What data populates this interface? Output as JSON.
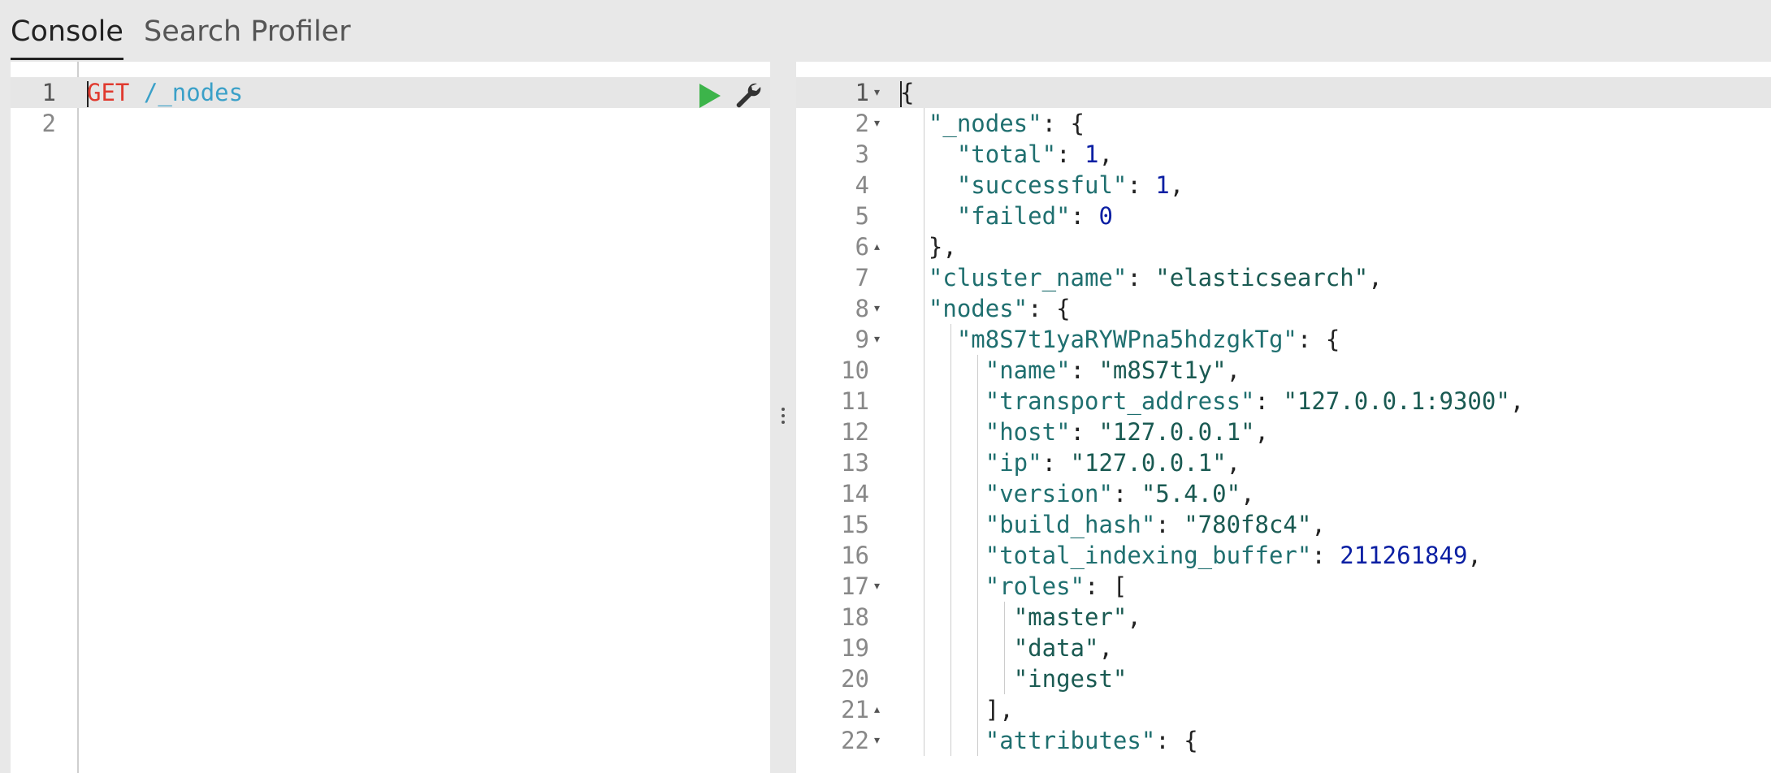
{
  "tabs": [
    {
      "label": "Console",
      "active": true
    },
    {
      "label": "Search Profiler",
      "active": false
    }
  ],
  "request": {
    "lines": [
      {
        "num": "1",
        "method": "GET",
        "path": "/_nodes"
      },
      {
        "num": "2",
        "method": "",
        "path": ""
      }
    ],
    "actions": {
      "run": "play-icon",
      "settings": "wrench-icon"
    }
  },
  "response": {
    "lines": [
      {
        "num": "1",
        "fold": "open",
        "text": "{"
      },
      {
        "num": "2",
        "fold": "open",
        "text": "  \"_nodes\": {"
      },
      {
        "num": "3",
        "fold": "",
        "text": "    \"total\": 1,"
      },
      {
        "num": "4",
        "fold": "",
        "text": "    \"successful\": 1,"
      },
      {
        "num": "5",
        "fold": "",
        "text": "    \"failed\": 0"
      },
      {
        "num": "6",
        "fold": "close",
        "text": "  },"
      },
      {
        "num": "7",
        "fold": "",
        "text": "  \"cluster_name\": \"elasticsearch\","
      },
      {
        "num": "8",
        "fold": "open",
        "text": "  \"nodes\": {"
      },
      {
        "num": "9",
        "fold": "open",
        "text": "    \"m8S7t1yaRYWPna5hdzgkTg\": {"
      },
      {
        "num": "10",
        "fold": "",
        "text": "      \"name\": \"m8S7t1y\","
      },
      {
        "num": "11",
        "fold": "",
        "text": "      \"transport_address\": \"127.0.0.1:9300\","
      },
      {
        "num": "12",
        "fold": "",
        "text": "      \"host\": \"127.0.0.1\","
      },
      {
        "num": "13",
        "fold": "",
        "text": "      \"ip\": \"127.0.0.1\","
      },
      {
        "num": "14",
        "fold": "",
        "text": "      \"version\": \"5.4.0\","
      },
      {
        "num": "15",
        "fold": "",
        "text": "      \"build_hash\": \"780f8c4\","
      },
      {
        "num": "16",
        "fold": "",
        "text": "      \"total_indexing_buffer\": 211261849,"
      },
      {
        "num": "17",
        "fold": "open",
        "text": "      \"roles\": ["
      },
      {
        "num": "18",
        "fold": "",
        "text": "        \"master\","
      },
      {
        "num": "19",
        "fold": "",
        "text": "        \"data\","
      },
      {
        "num": "20",
        "fold": "",
        "text": "        \"ingest\""
      },
      {
        "num": "21",
        "fold": "close",
        "text": "      ],"
      },
      {
        "num": "22",
        "fold": "open",
        "text": "      \"attributes\": {"
      }
    ]
  },
  "colors": {
    "method": "#e03a2f",
    "path": "#3aa0c8",
    "key": "#1f6f6f",
    "string": "#1a5a52",
    "number": "#0b1fa3",
    "run_button": "#3cb44a"
  }
}
